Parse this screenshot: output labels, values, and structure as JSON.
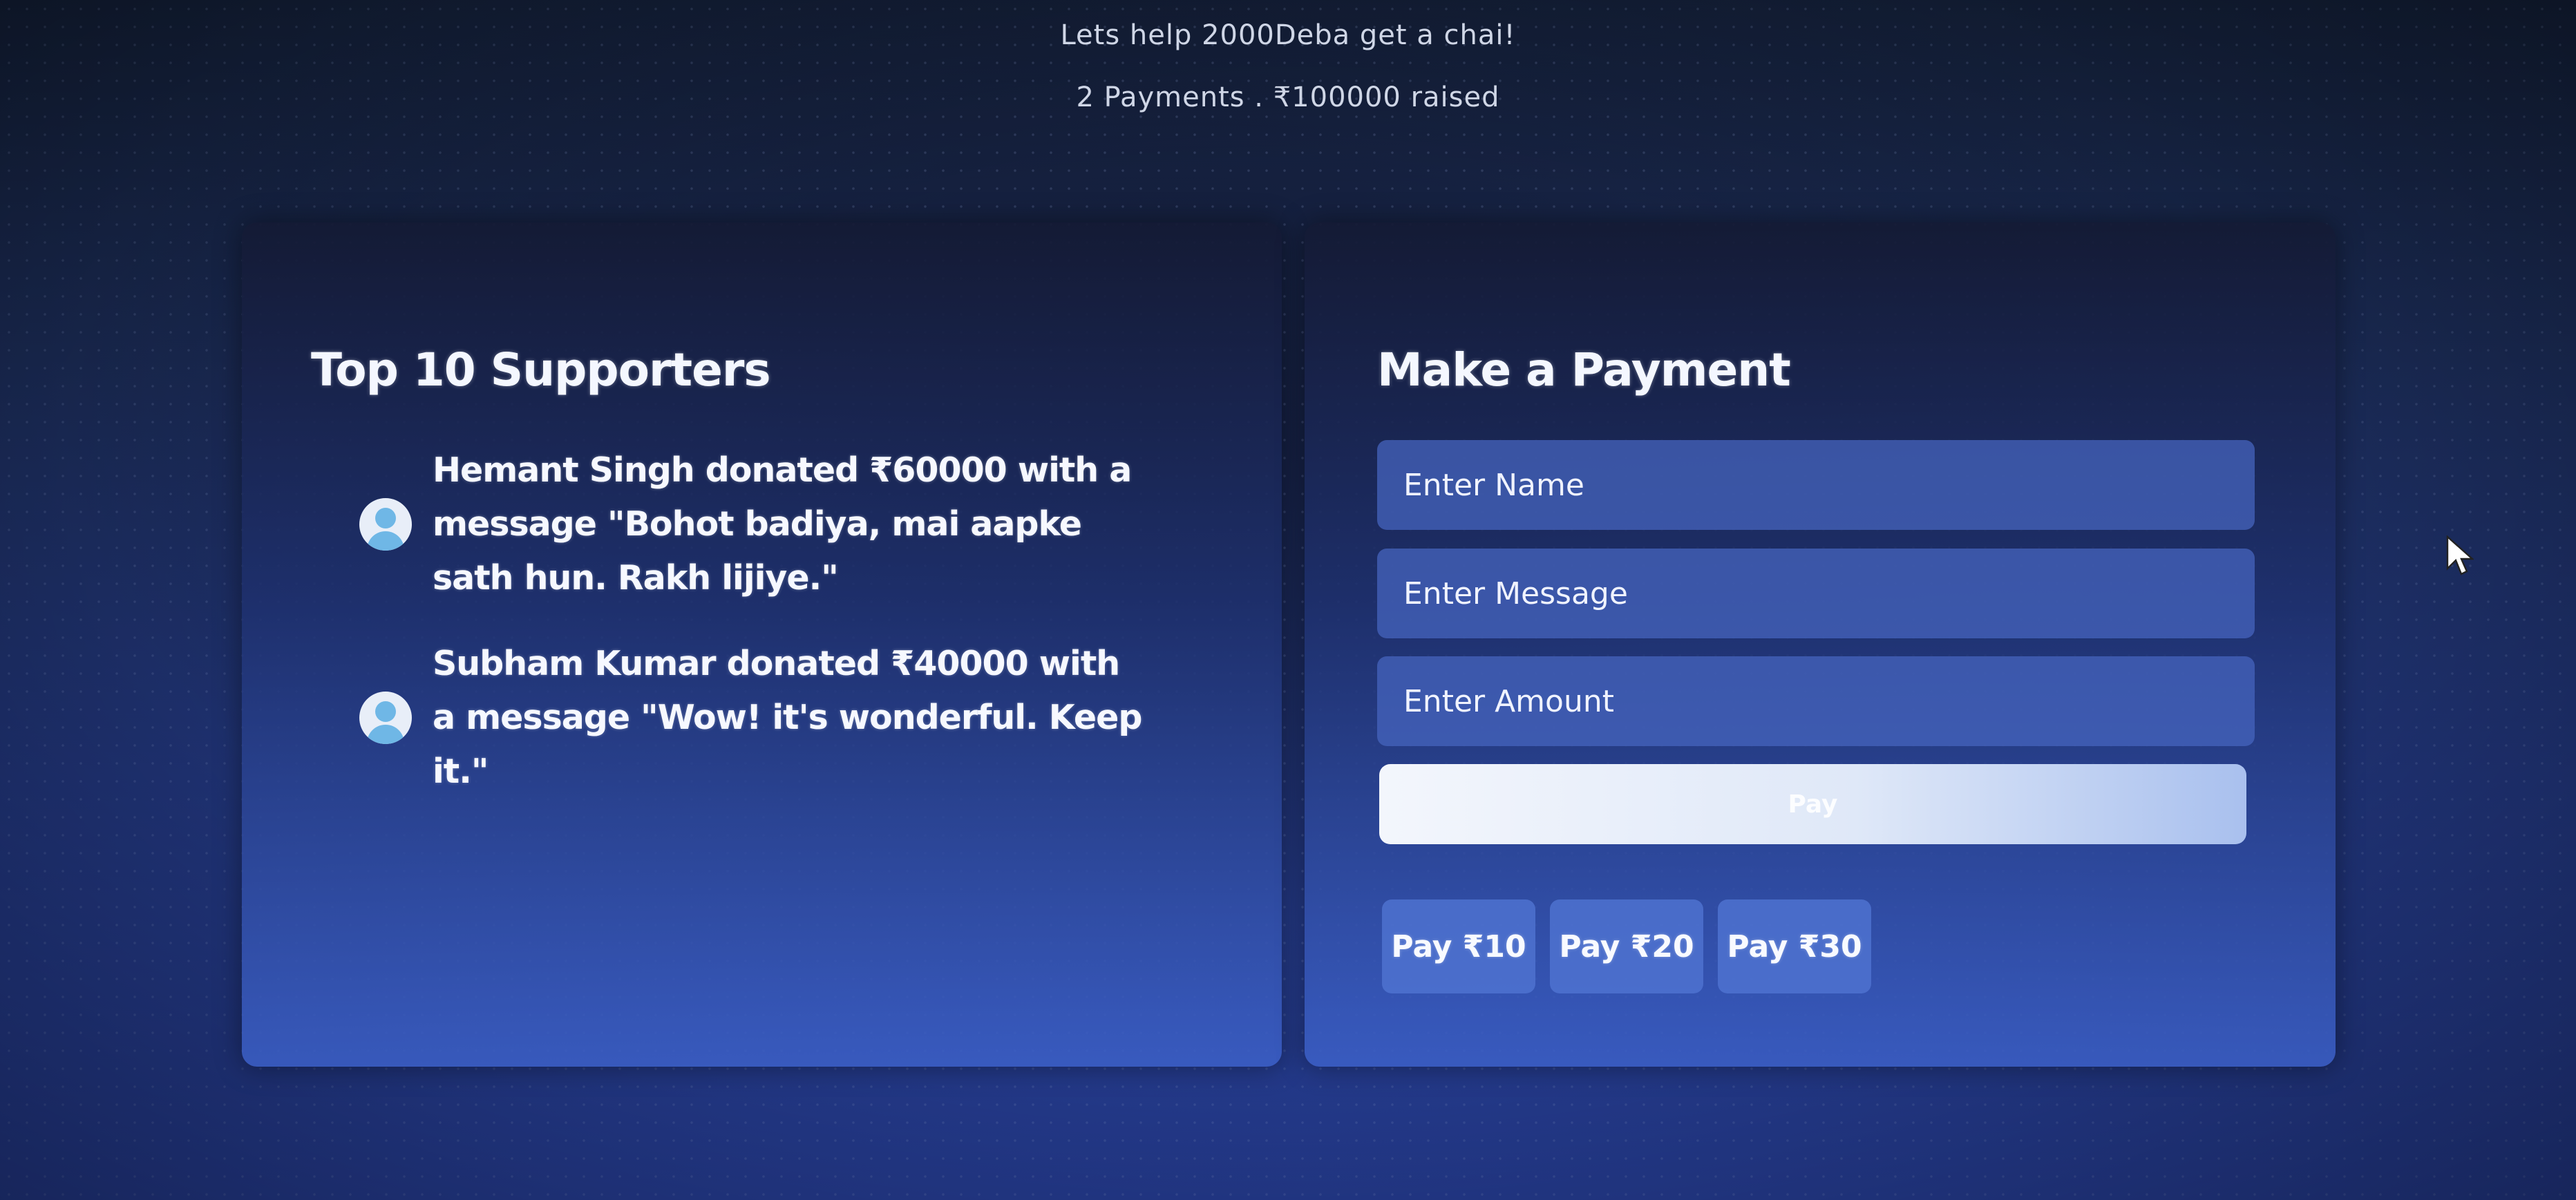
{
  "header": {
    "title": "Lets help 2000Deba get a chai!",
    "stats": "2 Payments . ₹100000 raised"
  },
  "supporters": {
    "heading": "Top 10 Supporters",
    "items": [
      {
        "text": "Hemant Singh donated ₹60000 with a message \"Bohot badiya, mai aapke sath hun. Rakh lijiye.\"",
        "icon": "user-avatar-icon"
      },
      {
        "text": "Subham Kumar donated ₹40000 with a message \"Wow! it's wonderful. Keep it.\"",
        "icon": "user-avatar-icon"
      }
    ]
  },
  "payment": {
    "heading": "Make a Payment",
    "name_placeholder": "Enter Name",
    "message_placeholder": "Enter Message",
    "amount_placeholder": "Enter Amount",
    "pay_label": "Pay",
    "quick_amounts": [
      "Pay ₹10",
      "Pay ₹20",
      "Pay ₹30"
    ]
  },
  "colors": {
    "background": "#243a86",
    "panel": "#1e306e",
    "field": "#4664be",
    "button": "#e6edf9",
    "avatar": "#6fb7e6"
  }
}
